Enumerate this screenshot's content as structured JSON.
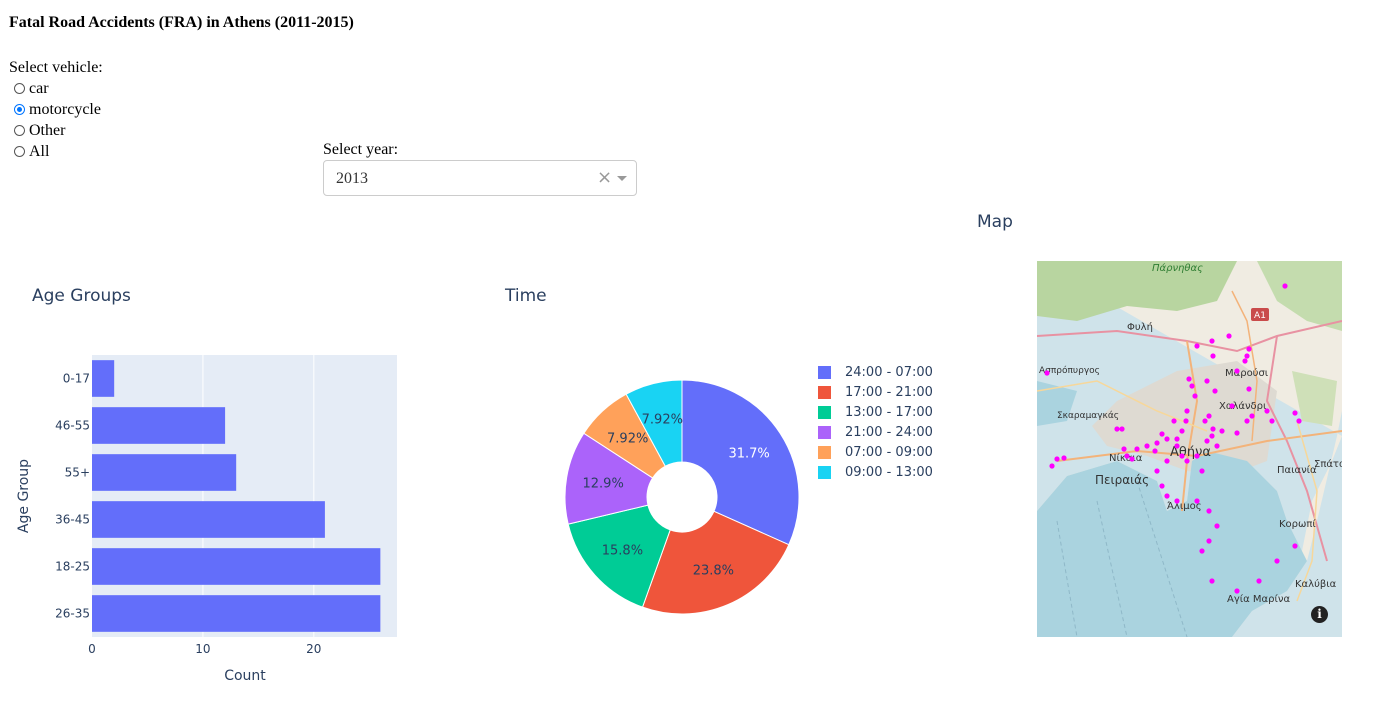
{
  "page": {
    "title": "Fatal Road Accidents (FRA) in Athens (2011-2015)"
  },
  "vehicle": {
    "label": "Select vehicle:",
    "options": [
      "car",
      "motorcycle",
      "Other",
      "All"
    ],
    "selected": "motorcycle"
  },
  "year": {
    "label": "Select year:",
    "value": "2013",
    "clear_symbol": "×"
  },
  "charts": {
    "age_title": "Age Groups",
    "time_title": "Time",
    "map_title": "Map"
  },
  "chart_data": [
    {
      "type": "bar",
      "orientation": "horizontal",
      "title": "Age Groups",
      "xlabel": "Count",
      "ylabel": "Age Group",
      "categories": [
        "0-17",
        "46-55",
        "55+",
        "36-45",
        "18-25",
        "26-35"
      ],
      "values": [
        2,
        12,
        13,
        21,
        26,
        26
      ],
      "xlim": [
        0,
        27.5
      ],
      "xticks": [
        0,
        10,
        20
      ],
      "grid": true,
      "bar_color": "#636efa"
    },
    {
      "type": "pie",
      "hole": true,
      "title": "Time",
      "labels": [
        "24:00 - 07:00",
        "17:00 - 21:00",
        "13:00 - 17:00",
        "21:00 - 24:00",
        "07:00 - 09:00",
        "09:00 - 13:00"
      ],
      "values": [
        31.7,
        23.8,
        15.8,
        12.9,
        7.92,
        7.92
      ],
      "display_labels": [
        "31.7%",
        "23.8%",
        "15.8%",
        "12.9%",
        "7.92%",
        "7.92%"
      ],
      "colors": [
        "#636efa",
        "#ef553b",
        "#00cc96",
        "#ab63fa",
        "#ffa15a",
        "#19d3f3"
      ],
      "legend_position": "right"
    }
  ],
  "map": {
    "labels": [
      "Πάρνηθας",
      "Φυλή",
      "Ασπρόπυργος",
      "Μαρούσι",
      "Χαλάνδρι",
      "Σκαραμαγκάς",
      "Νίκαια",
      "Αθήνα",
      "Πειραιάς",
      "Παιανία",
      "Σπάτα",
      "Κορωπί",
      "Καλύβια",
      "Αγία Μαρίνα",
      "Άλιμος",
      "A1"
    ],
    "marker_color": "#ff00ff",
    "info_symbol": "i"
  }
}
